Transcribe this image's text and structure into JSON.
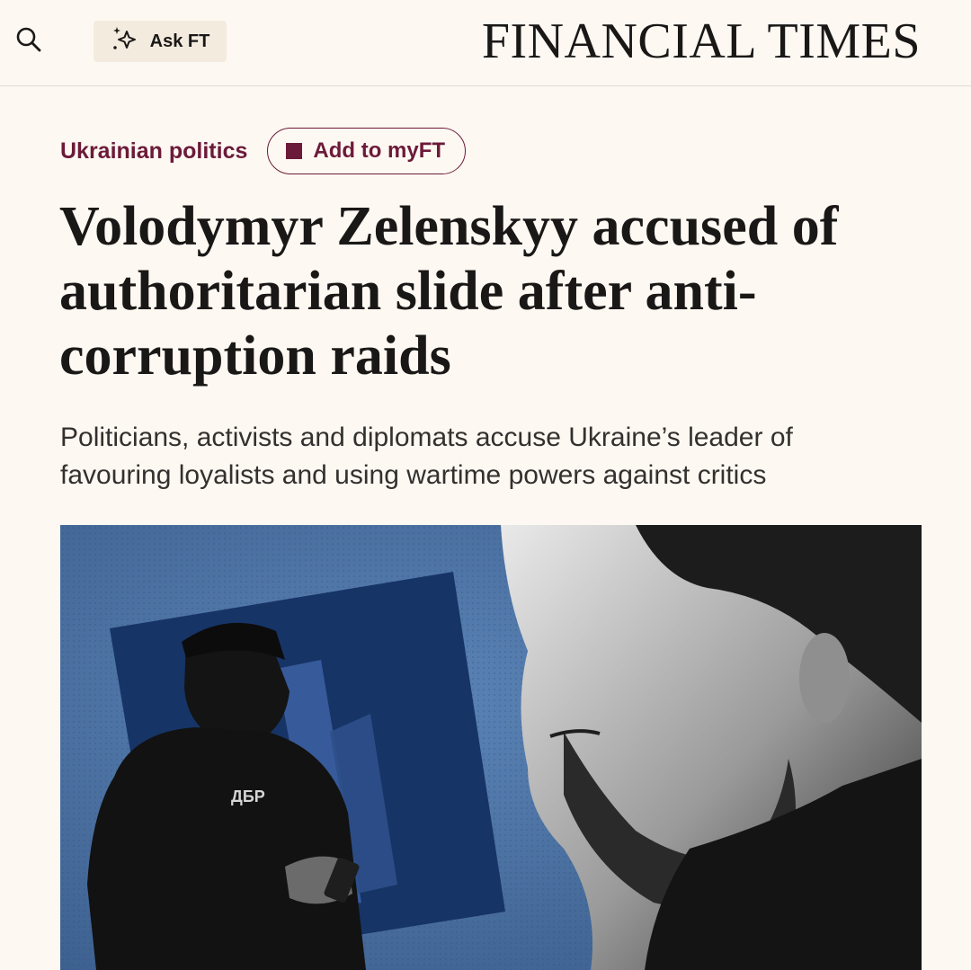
{
  "header": {
    "search_icon": "search-icon",
    "askft_icon": "sparkle-icon",
    "askft_label": "Ask FT",
    "masthead": "FINANCIAL TIMES"
  },
  "article": {
    "topic": "Ukrainian politics",
    "myft_label": "Add to myFT",
    "headline": "Volodymyr Zelenskyy accused of authoritarian slide after anti-corruption raids",
    "standfirst": "Politicians, activists and diplomats accuse Ukraine’s leader of favouring loyalists and using wartime powers against critics",
    "image": {
      "vest_text": "ДБР"
    }
  },
  "colors": {
    "background": "#fdf8f2",
    "accent": "#6c1a3a",
    "hero_blue": "#4a6f9c",
    "askft_bg": "#f4ebdf"
  }
}
